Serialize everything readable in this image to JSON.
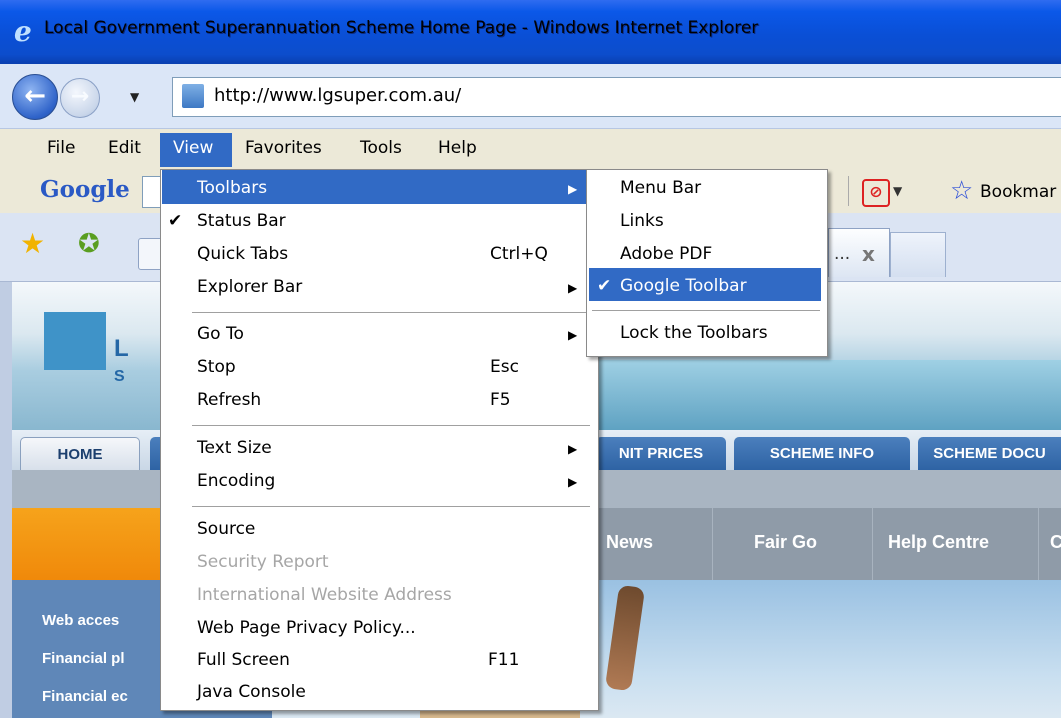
{
  "window": {
    "title": "Local Government Superannuation Scheme Home Page - Windows Internet Explorer",
    "app_icon": "internet-explorer-icon"
  },
  "address_bar": {
    "url": "http://www.lgsuper.com.au/"
  },
  "menubar": {
    "items": [
      {
        "label": "File"
      },
      {
        "label": "Edit"
      },
      {
        "label": "View",
        "open": true
      },
      {
        "label": "Favorites"
      },
      {
        "label": "Tools"
      },
      {
        "label": "Help"
      }
    ]
  },
  "google_toolbar": {
    "logo": "Google",
    "bookmarks_label": "Bookmar"
  },
  "tab": {
    "label": "...",
    "close": "x"
  },
  "view_menu": {
    "items": [
      {
        "label": "Toolbars",
        "submenu": true,
        "highlighted": true
      },
      {
        "label": "Status Bar",
        "checked": true
      },
      {
        "label": "Quick Tabs",
        "shortcut": "Ctrl+Q"
      },
      {
        "label": "Explorer Bar",
        "submenu": true
      },
      {
        "label": "Go To",
        "submenu": true
      },
      {
        "label": "Stop",
        "shortcut": "Esc"
      },
      {
        "label": "Refresh",
        "shortcut": "F5"
      },
      {
        "label": "Text Size",
        "submenu": true
      },
      {
        "label": "Encoding",
        "submenu": true
      },
      {
        "label": "Source"
      },
      {
        "label": "Security Report",
        "disabled": true
      },
      {
        "label": "International Website Address",
        "disabled": true
      },
      {
        "label": "Web Page Privacy Policy..."
      },
      {
        "label": "Full Screen",
        "shortcut": "F11"
      },
      {
        "label": "Java Console"
      }
    ]
  },
  "toolbars_submenu": {
    "items": [
      {
        "label": "Menu Bar"
      },
      {
        "label": "Links"
      },
      {
        "label": "Adobe PDF"
      },
      {
        "label": "Google Toolbar",
        "checked": true,
        "highlighted": true
      },
      {
        "label": "Lock the Toolbars"
      }
    ]
  },
  "webpage": {
    "logo_letters": [
      "L",
      "S"
    ],
    "nav_tabs": [
      "HOME",
      "NIT PRICES",
      "SCHEME INFO",
      "SCHEME DOCU"
    ],
    "top_links": [
      "News",
      "Fair Go",
      "Help Centre",
      "C"
    ],
    "left_links": [
      "Web acces",
      "Financial pl",
      "Financial ec"
    ]
  },
  "colors": {
    "menu_highlight": "#316ac5",
    "titlebar": "#0b58e8",
    "orange_banner": "#f39a12"
  }
}
